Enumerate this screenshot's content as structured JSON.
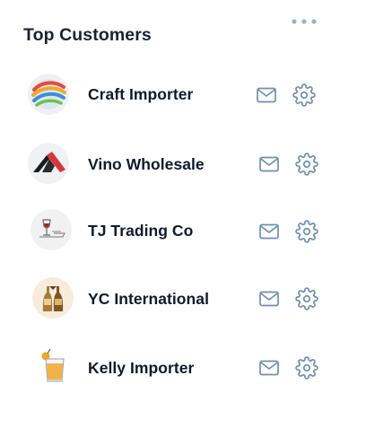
{
  "header": {
    "title": "Top Customers",
    "menu_icon": "more-horizontal-icon"
  },
  "customers": [
    {
      "name": "Craft Importer",
      "logo": "globe-swirl-logo"
    },
    {
      "name": "Vino Wholesale",
      "logo": "roof-house-logo"
    },
    {
      "name": "TJ Trading Co",
      "logo": "wine-glass-sketch-logo"
    },
    {
      "name": "YC International",
      "logo": "bottles-logo"
    },
    {
      "name": "Kelly Importer",
      "logo": "drink-glass-logo"
    }
  ],
  "row_actions": {
    "mail_icon": "mail-icon",
    "settings_icon": "gear-icon"
  },
  "colors": {
    "title": "#1a2233",
    "name": "#111a2c",
    "action_icon": "#6f8fb0",
    "menu_dots": "#9fb0c4"
  }
}
